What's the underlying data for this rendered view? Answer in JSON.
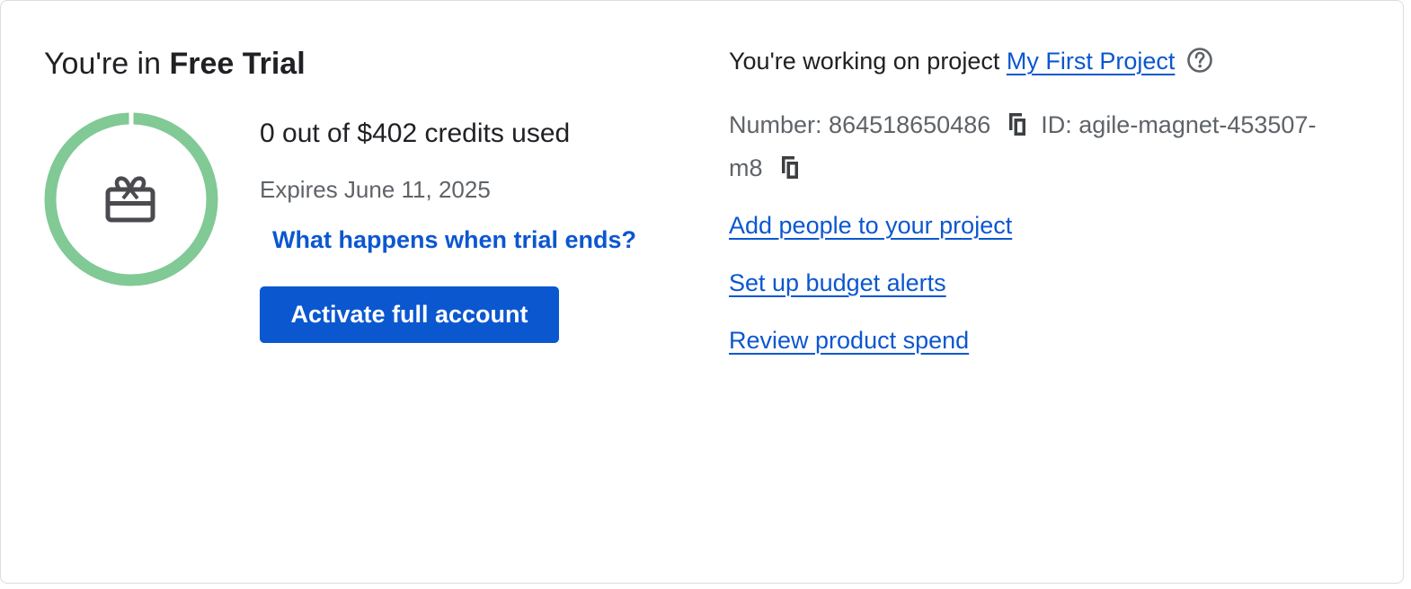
{
  "trial": {
    "title_prefix": "You're in",
    "title_bold": "Free Trial",
    "credits_text": "0 out of $402 credits used",
    "credits_used_fraction": 0,
    "expires_text": "Expires June 11, 2025",
    "trial_link": "What happens when trial ends?",
    "activate_button": "Activate full account",
    "ring_color": "#81c995",
    "icon": "card-giftcard-icon"
  },
  "project": {
    "working_prefix": "You're working on project",
    "project_name": "My First Project",
    "help_icon": "help-circle-icon",
    "number_label": "Number:",
    "number_value": "864518650486",
    "id_label": "ID:",
    "id_value": "agile-magnet-453507-m8",
    "copy_icon": "copy-icon"
  },
  "links": {
    "add_people": "Add people to your project",
    "budget_alerts": "Set up budget alerts",
    "review_spend": "Review product spend"
  },
  "colors": {
    "link": "#0b57d0",
    "button": "#0b57d0",
    "secondary_text": "#5f6368",
    "ring": "#81c995"
  }
}
